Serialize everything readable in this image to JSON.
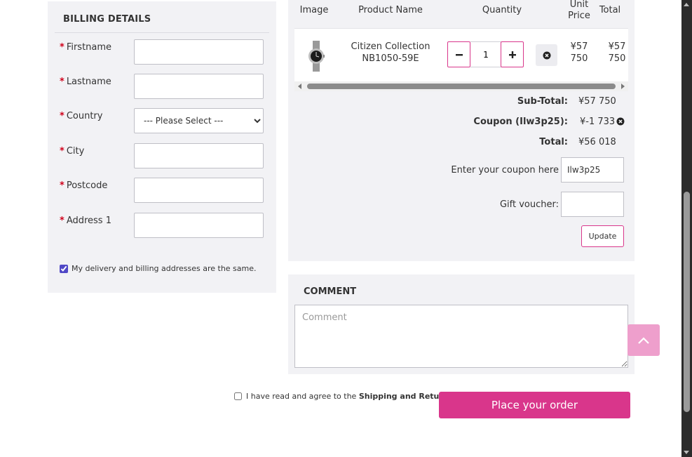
{
  "billing": {
    "title": "BILLING DETAILS",
    "required_mark": "*",
    "fields": {
      "firstname": "Firstname",
      "lastname": "Lastname",
      "country": "Country",
      "city": "City",
      "postcode": "Postcode",
      "address1": "Address 1"
    },
    "country_select_value": "--- Please Select ---",
    "same_address_label": "My delivery and billing addresses are the same.",
    "same_address_checked": true
  },
  "cart": {
    "columns": {
      "image": "Image",
      "product_name": "Product Name",
      "quantity": "Quantity",
      "unit_price": "Unit Price",
      "total": "Total"
    },
    "item": {
      "name": "Citizen Collection NB1050-59E",
      "quantity": "1",
      "unit_price": "¥57 750",
      "total": "¥57 750"
    },
    "totals": {
      "subtotal_label": "Sub-Total:",
      "subtotal_value": "¥57 750",
      "coupon_label": "Coupon (Ilw3p25):",
      "coupon_value": "¥-1 733",
      "total_label": "Total:",
      "total_value": "¥56 018"
    },
    "coupon_input_label": "Enter your coupon here",
    "coupon_input_value": "Ilw3p25",
    "gift_voucher_label": "Gift voucher:",
    "gift_voucher_value": "",
    "update_label": "Update"
  },
  "comment": {
    "title": "COMMENT",
    "placeholder": "Comment"
  },
  "agree": {
    "text": "I have read and agree to the ",
    "link": "Shipping and Returns",
    "checked": false
  },
  "place_order_label": "Place your order",
  "icons": {
    "minus": "minus-icon",
    "plus": "plus-icon",
    "remove": "remove-circle-icon",
    "scroll_top": "chevron-up-icon"
  },
  "colors": {
    "accent": "#d9368b",
    "accent_light": "#ee9fcc",
    "panel": "#f2f2f5",
    "required": "#d0021b"
  }
}
